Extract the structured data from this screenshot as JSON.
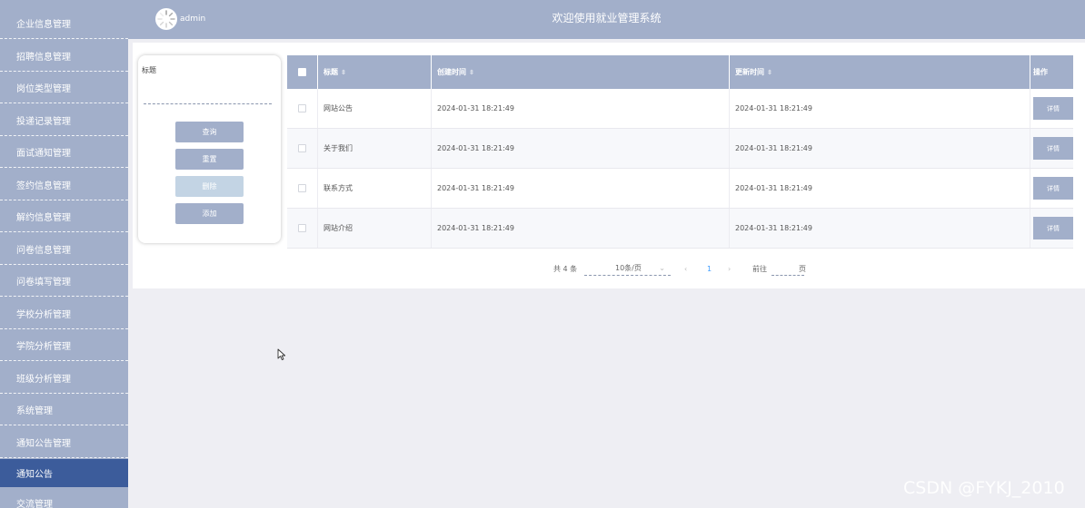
{
  "sidebar": {
    "items": [
      {
        "label": "企业信息管理",
        "active": false
      },
      {
        "label": "招聘信息管理",
        "active": false
      },
      {
        "label": "岗位类型管理",
        "active": false
      },
      {
        "label": "投递记录管理",
        "active": false
      },
      {
        "label": "面试通知管理",
        "active": false
      },
      {
        "label": "签约信息管理",
        "active": false
      },
      {
        "label": "解约信息管理",
        "active": false
      },
      {
        "label": "问卷信息管理",
        "active": false
      },
      {
        "label": "问卷填写管理",
        "active": false
      },
      {
        "label": "学校分析管理",
        "active": false
      },
      {
        "label": "学院分析管理",
        "active": false
      },
      {
        "label": "班级分析管理",
        "active": false
      },
      {
        "label": "系统管理",
        "active": false
      },
      {
        "label": "通知公告管理",
        "active": false
      },
      {
        "label": "通知公告",
        "active": true
      },
      {
        "label": "交流管理",
        "active": false
      }
    ]
  },
  "header": {
    "username": "admin",
    "title": "欢迎使用就业管理系统"
  },
  "search": {
    "label": "标题",
    "value": "",
    "placeholder": "",
    "query_btn": "查询",
    "reset_btn": "重置",
    "delete_btn": "删除",
    "add_btn": "添加"
  },
  "table": {
    "columns": {
      "title": "标题",
      "created": "创建时间",
      "updated": "更新时间",
      "op": "操作"
    },
    "rows": [
      {
        "title": "网站公告",
        "created": "2024-01-31 18:21:49",
        "updated": "2024-01-31 18:21:49",
        "op": "详情"
      },
      {
        "title": "关于我们",
        "created": "2024-01-31 18:21:49",
        "updated": "2024-01-31 18:21:49",
        "op": "详情"
      },
      {
        "title": "联系方式",
        "created": "2024-01-31 18:21:49",
        "updated": "2024-01-31 18:21:49",
        "op": "详情"
      },
      {
        "title": "网站介绍",
        "created": "2024-01-31 18:21:49",
        "updated": "2024-01-31 18:21:49",
        "op": "详情"
      }
    ]
  },
  "pagination": {
    "total": "共 4 条",
    "page_size": "10条/页",
    "current_page": "1",
    "goto_label": "前往",
    "page_suffix": "页"
  },
  "watermark": "CSDN @FYKJ_2010",
  "colors": {
    "primary": "#a2afca",
    "sidebar_active": "#3c5c9b",
    "background": "#eeeef3",
    "pager_active": "#409eff"
  }
}
